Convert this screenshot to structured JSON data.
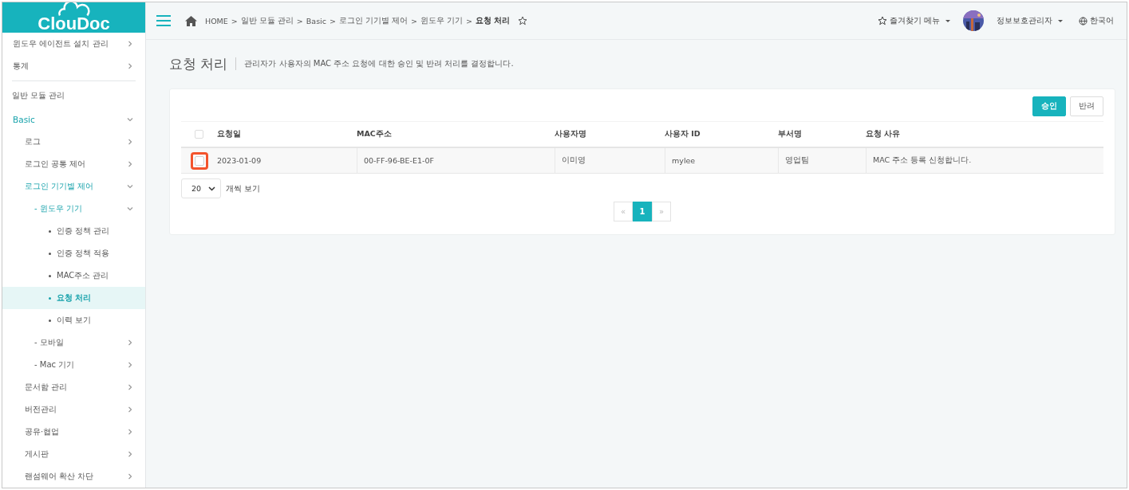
{
  "logo": "ClouDoc",
  "breadcrumb": [
    {
      "label": "HOME",
      "current": false
    },
    {
      "label": "일반 모듈 관리",
      "current": false
    },
    {
      "label": "Basic",
      "current": false
    },
    {
      "label": "로그인 기기별 제어",
      "current": false
    },
    {
      "label": "윈도우 기기",
      "current": false
    },
    {
      "label": "요청 처리",
      "current": true
    }
  ],
  "breadcrumb_separator": ">",
  "header": {
    "favorites": "즐겨찾기 메뉴",
    "user": "정보보호관리자",
    "language": "한국어"
  },
  "sidebar": {
    "top_items": [
      {
        "label": "윈도우 에이전트 설치 관리"
      },
      {
        "label": "통계"
      }
    ],
    "section": "일반 모듈 관리",
    "items": [
      {
        "label": "Basic",
        "expanded": true,
        "selected": false,
        "children": [
          {
            "label": "로그",
            "expanded": false,
            "selected": false
          },
          {
            "label": "로그인 공통 제어",
            "expanded": false,
            "selected": false
          },
          {
            "label": "로그인 기기별 제어",
            "expanded": true,
            "selected": false,
            "children": [
              {
                "label": "- 윈도우 기기",
                "expanded": true,
                "selected": false,
                "children": [
                  {
                    "label": "인증 정책 관리",
                    "selected": false
                  },
                  {
                    "label": "인증 정책 적용",
                    "selected": false
                  },
                  {
                    "label": "MAC주소 관리",
                    "selected": false
                  },
                  {
                    "label": "요청 처리",
                    "selected": true
                  },
                  {
                    "label": "이력 보기",
                    "selected": false
                  }
                ]
              },
              {
                "label": "- 모바일",
                "expanded": false,
                "selected": false
              },
              {
                "label": "- Mac 기기",
                "expanded": false,
                "selected": false
              }
            ]
          },
          {
            "label": "문서함 관리",
            "expanded": false,
            "selected": false
          },
          {
            "label": "버전관리",
            "expanded": false,
            "selected": false
          },
          {
            "label": "공유·협업",
            "expanded": false,
            "selected": false
          },
          {
            "label": "게시판",
            "expanded": false,
            "selected": false
          },
          {
            "label": "랜섬웨어 확산 차단",
            "expanded": false,
            "selected": false
          }
        ]
      }
    ]
  },
  "page": {
    "title": "요청 처리",
    "description": "관리자가 사용자의 MAC 주소 요청에 대한 승인 및 반려 처리를 결정합니다."
  },
  "actions": [
    {
      "label": "승인",
      "kind": "primary"
    },
    {
      "label": "반려",
      "kind": "default"
    }
  ],
  "table": {
    "all_checked": false,
    "columns": [
      "요청일",
      "MAC주소",
      "사용자명",
      "사용자 ID",
      "부서명",
      "요청 사유"
    ],
    "rows": [
      {
        "checked": false,
        "highlighted": true,
        "cells": [
          "2023-01-09",
          "00-FF-96-BE-E1-0F",
          "이미영",
          "mylee",
          "영업팀",
          "MAC 주소 등록 신청합니다."
        ]
      }
    ]
  },
  "page_size": {
    "value": "20",
    "label": "개씩 보기"
  },
  "pagination": {
    "prev": "«",
    "next": "»",
    "pages": [
      {
        "label": "1",
        "selected": true
      }
    ]
  }
}
